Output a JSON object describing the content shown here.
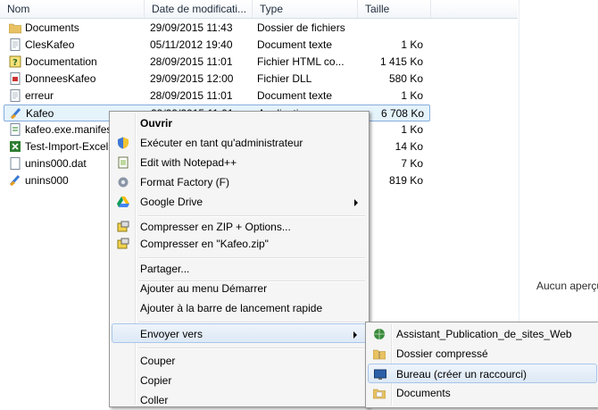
{
  "columns": {
    "name": "Nom",
    "date": "Date de modificati...",
    "type": "Type",
    "size": "Taille"
  },
  "files": [
    {
      "name": "Documents",
      "date": "29/09/2015 11:43",
      "type": "Dossier de fichiers",
      "size": "",
      "icon": "folder-icon"
    },
    {
      "name": "ClesKafeo",
      "date": "05/11/2012 19:40",
      "type": "Document texte",
      "size": "1 Ko",
      "icon": "text-file-icon"
    },
    {
      "name": "Documentation",
      "date": "28/09/2015 11:01",
      "type": "Fichier HTML co...",
      "size": "1 415 Ko",
      "icon": "help-file-icon"
    },
    {
      "name": "DonneesKafeo",
      "date": "29/09/2015 12:00",
      "type": "Fichier DLL",
      "size": "580 Ko",
      "icon": "dll-file-icon"
    },
    {
      "name": "erreur",
      "date": "28/09/2015 11:01",
      "type": "Document texte",
      "size": "1 Ko",
      "icon": "text-file-icon"
    },
    {
      "name": "Kafeo",
      "date": "29/09/2015 11:01",
      "type": "Application",
      "size": "6 708 Ko",
      "icon": "application-icon"
    },
    {
      "name": "kafeo.exe.manifest",
      "date": "",
      "type": "",
      "size": "1 Ko",
      "icon": "manifest-file-icon"
    },
    {
      "name": "Test-Import-Excel",
      "date": "",
      "type": "",
      "size": "14 Ko",
      "icon": "excel-file-icon"
    },
    {
      "name": "unins000.dat",
      "date": "",
      "type": "",
      "size": "7 Ko",
      "icon": "dat-file-icon"
    },
    {
      "name": "unins000",
      "date": "",
      "type": "",
      "size": "819 Ko",
      "icon": "uninstall-icon"
    }
  ],
  "preview": {
    "text": "Aucun aperçu"
  },
  "context_menu": {
    "open": "Ouvrir",
    "run_as_admin": "Exécuter en tant qu'administrateur",
    "edit_notepad": "Edit with Notepad++",
    "format_factory": "Format Factory (F)",
    "google_drive": "Google Drive",
    "zip_options": "Compresser en ZIP + Options...",
    "zip_named": "Compresser en \"Kafeo.zip\"",
    "share": "Partager...",
    "pin_start": "Ajouter au menu Démarrer",
    "pin_quicklaunch": "Ajouter à la barre de lancement rapide",
    "send_to": "Envoyer vers",
    "cut": "Couper",
    "copy": "Copier",
    "paste": "Coller"
  },
  "send_to_menu": {
    "web_publish": "Assistant_Publication_de_sites_Web",
    "compressed": "Dossier compressé",
    "desktop": "Bureau (créer un raccourci)",
    "documents": "Documents"
  },
  "colors": {
    "selection": "#e5f3fb",
    "selection_border": "#84acdd",
    "menu_bg": "#f5f5f5"
  }
}
